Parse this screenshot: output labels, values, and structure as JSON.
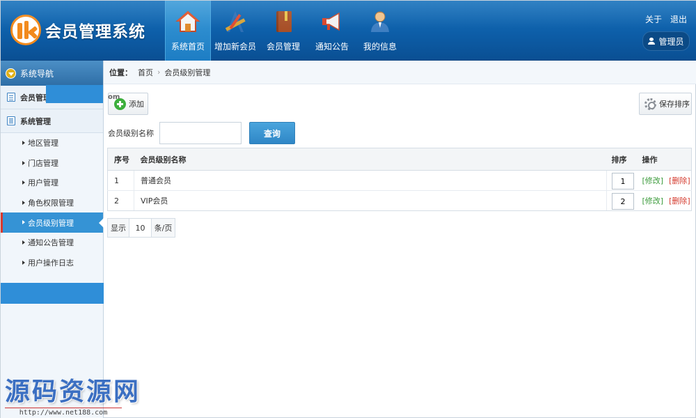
{
  "app": {
    "title": "会员管理系统",
    "brand_color": "#0d5ea8",
    "accent_color": "#3593d5"
  },
  "topnav": [
    {
      "label": "系统首页",
      "icon": "house-icon",
      "active": true
    },
    {
      "label": "增加新会员",
      "icon": "drafting-tools-icon",
      "active": false
    },
    {
      "label": "会员管理",
      "icon": "book-icon",
      "active": false
    },
    {
      "label": "通知公告",
      "icon": "megaphone-icon",
      "active": false
    },
    {
      "label": "我的信息",
      "icon": "person-icon",
      "active": false
    }
  ],
  "top_links": {
    "about": "关于",
    "logout": "退出"
  },
  "user": {
    "name": "管理员"
  },
  "sidebar": {
    "title": "系统导航",
    "groups": [
      {
        "label": "会员管理"
      },
      {
        "label": "系统管理"
      }
    ],
    "items": [
      {
        "label": "地区管理"
      },
      {
        "label": "门店管理"
      },
      {
        "label": "用户管理"
      },
      {
        "label": "角色权限管理"
      },
      {
        "label": "会员级别管理",
        "active": true
      },
      {
        "label": "通知公告管理"
      },
      {
        "label": "用户操作日志"
      }
    ]
  },
  "breadcrumb": {
    "prefix": "位置：",
    "home": "首页",
    "current": "会员级别管理"
  },
  "toolbar": {
    "add_label": "添加",
    "save_sort_label": "保存排序",
    "om_text": "om"
  },
  "search": {
    "label": "会员级别名称",
    "value": "",
    "button": "查询"
  },
  "table": {
    "headers": {
      "seq": "序号",
      "name": "会员级别名称",
      "sort": "排序",
      "ops": "操作"
    },
    "rows": [
      {
        "seq": "1",
        "name": "普通会员",
        "sort": "1",
        "edit": "[修改]",
        "delete": "[删除]"
      },
      {
        "seq": "2",
        "name": "VIP会员",
        "sort": "2",
        "edit": "[修改]",
        "delete": "[删除]"
      }
    ]
  },
  "pager": {
    "show": "显示",
    "size": "10",
    "unit": "条/页"
  },
  "watermark": {
    "text": "源码资源网",
    "url": "http://www.net188.com"
  }
}
